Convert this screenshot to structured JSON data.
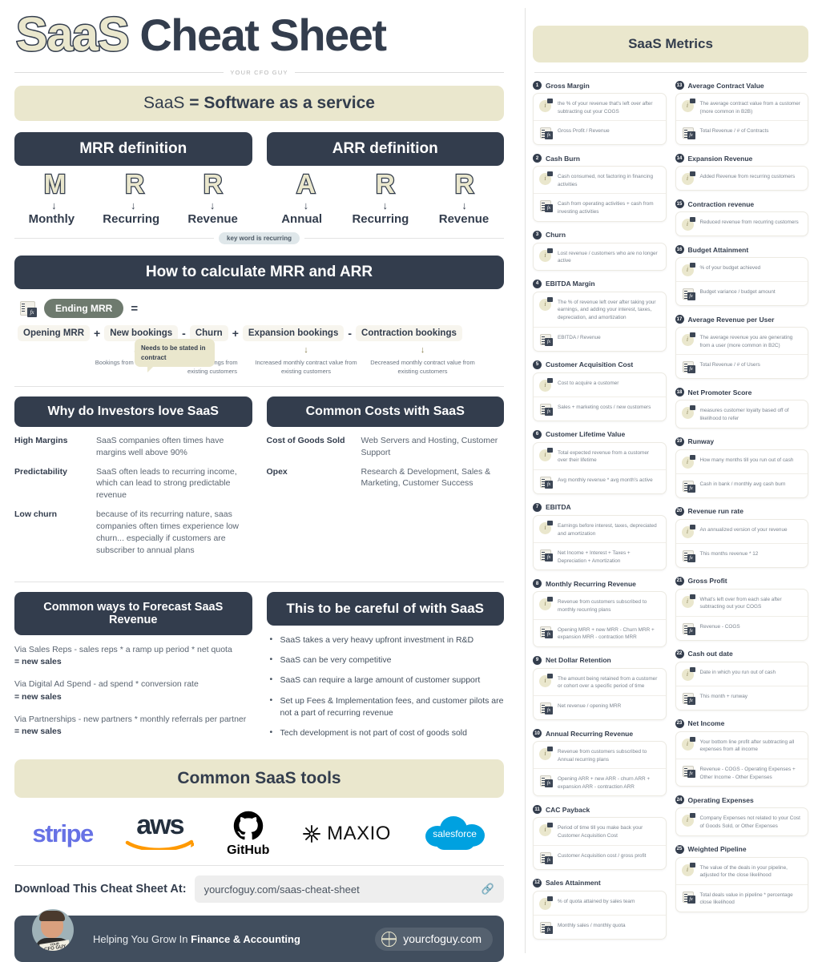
{
  "header": {
    "title_outline": "SaaS",
    "title_solid": "Cheat Sheet",
    "brand_line": "YOUR CFO GUY",
    "definition_light": "SaaS ",
    "definition_bold": "= Software as a service"
  },
  "mrr": {
    "heading": "MRR definition",
    "letters": [
      "M",
      "R",
      "R"
    ],
    "words": [
      "Monthly",
      "Recurring",
      "Revenue"
    ],
    "callout": "Needs to be stated in contract"
  },
  "arr": {
    "heading": "ARR definition",
    "letters": [
      "A",
      "R",
      "R"
    ],
    "words": [
      "Annual",
      "Recurring",
      "Revenue"
    ]
  },
  "keyword_badge": "key word is recurring",
  "calc": {
    "heading": "How to calculate MRR and ARR",
    "result_pill": "Ending MRR",
    "equals": "=",
    "terms": [
      "Opening MRR",
      "New bookings",
      "Churn",
      "Expansion bookings",
      "Contraction bookings"
    ],
    "operators": [
      "+",
      "-",
      "+",
      "-"
    ],
    "notes": [
      "",
      "Bookings from new customers",
      "Lost bookings from existing customers",
      "Increased monthly contract value from existing customers",
      "Decreased monthly contract value from existing customers"
    ]
  },
  "investors": {
    "heading": "Why do Investors love SaaS",
    "rows": [
      {
        "key": "High Margins",
        "value": "SaaS companies often times have margins well above 90%"
      },
      {
        "key": "Predictability",
        "value": "SaaS often leads to recurring income, which can lead to strong predictable revenue"
      },
      {
        "key": "Low churn",
        "value": "because of its recurring nature, saas companies often times experience low churn... especially if customers are subscriber to annual plans"
      }
    ]
  },
  "costs": {
    "heading": "Common Costs with SaaS",
    "rows": [
      {
        "key": "Cost of Goods Sold",
        "value": "Web Servers and Hosting, Customer Support"
      },
      {
        "key": "Opex",
        "value": "Research & Development, Sales & Marketing, Customer Success"
      }
    ]
  },
  "forecast": {
    "heading": "Common ways to Forecast SaaS Revenue",
    "items": [
      {
        "line": "Via Sales Reps - sales reps * a ramp up period * net quota",
        "result": "= new sales"
      },
      {
        "line": "Via Digital Ad Spend - ad spend * conversion rate",
        "result": "= new sales"
      },
      {
        "line": "Via Partnerships - new partners * monthly referrals per partner",
        "result": "= new sales"
      }
    ]
  },
  "careful": {
    "heading": "This to be careful of with SaaS",
    "items": [
      "SaaS takes a very heavy upfront investment in R&D",
      "SaaS can be very competitive",
      "SaaS can require a large amount of customer support",
      "Set up Fees & Implementation fees, and customer pilots are not a part of recurring revenue",
      "Tech development is not part of cost of goods sold"
    ]
  },
  "tools": {
    "heading": "Common SaaS tools",
    "logos": [
      "stripe",
      "aws",
      "GitHub",
      "MAXIO",
      "salesforce"
    ]
  },
  "download": {
    "label": "Download This Cheat Sheet At:",
    "url": "yourcfoguy.com/saas-cheat-sheet"
  },
  "footer": {
    "text_light": "Helping You Grow In ",
    "text_bold": "Finance & Accounting",
    "site": "yourcfoguy.com",
    "badge_small": "YOUR",
    "badge_main": "CFO GUY"
  },
  "metrics": {
    "heading": "SaaS Metrics",
    "left": [
      {
        "num": "1",
        "name": "Gross Margin",
        "desc": "the % of your revenue that's left over after subtracting out your COGS",
        "formula": "Gross Profit / Revenue"
      },
      {
        "num": "2",
        "name": "Cash Burn",
        "desc": "Cash consumed, not factoring in financing activities",
        "formula": "Cash from operating activities + cash from investing activities"
      },
      {
        "num": "3",
        "name": "Churn",
        "desc": "Lost revenue / customers who are no longer active",
        "formula": ""
      },
      {
        "num": "4",
        "name": "EBITDA Margin",
        "desc": "The % of revenue left over after taking your earnings, and adding your interest, taxes, depreciation, and amortization",
        "formula": "EBITDA / Revenue"
      },
      {
        "num": "5",
        "name": "Customer Acquisition Cost",
        "desc": "Cost to acquire a customer",
        "formula": "Sales + marketing costs / new customers"
      },
      {
        "num": "6",
        "name": "Customer Lifetime Value",
        "desc": "Total expected revenue from a customer over their lifetime",
        "formula": "Avg monthly revenue * avg month's active"
      },
      {
        "num": "7",
        "name": "EBITDA",
        "desc": "Earnings before interest, taxes, depreciated and amortization",
        "formula": "Net Income + Interest + Taxes + Depreciation + Amortization"
      },
      {
        "num": "8",
        "name": "Monthly Recurring Revenue",
        "desc": "Revenue from customers subscribed to monthly recurring plans",
        "formula": "Opening MRR + new MRR - Churn MRR + expansion MRR - contraction MRR"
      },
      {
        "num": "9",
        "name": "Net Dollar Retention",
        "desc": "The amount being retained from a customer or cohort over a specific period of time",
        "formula": "Net revenue / opening MRR"
      },
      {
        "num": "10",
        "name": "Annual Recurring Revenue",
        "desc": "Revenue from customers subscribed to Annual recurring plans",
        "formula": "Opening ARR + new ARR - churn ARR + expansion ARR - contraction ARR"
      },
      {
        "num": "11",
        "name": "CAC Payback",
        "desc": "Period of time till you make back your Customer Acquisition Cost",
        "formula": "Customer Acquisition cost / gross profit"
      },
      {
        "num": "12",
        "name": "Sales Attainment",
        "desc": "% of quota attained by sales team",
        "formula": "Monthly sales / monthly quota"
      }
    ],
    "right": [
      {
        "num": "13",
        "name": "Average Contract Value",
        "desc": "The average contract value from a customer (more common in B2B)",
        "formula": "Total Revenue / # of Contracts"
      },
      {
        "num": "14",
        "name": "Expansion Revenue",
        "desc": "Added Revenue from recurring customers",
        "formula": ""
      },
      {
        "num": "15",
        "name": "Contraction revenue",
        "desc": "Reduced revenue from recurring customers",
        "formula": ""
      },
      {
        "num": "16",
        "name": "Budget Attainment",
        "desc": "% of your budget achieved",
        "formula": "Budget variance / budget amount"
      },
      {
        "num": "17",
        "name": "Average Revenue per User",
        "desc": "The average revenue you are generating from a user (more common in B2C)",
        "formula": "Total Revenue / # of Users"
      },
      {
        "num": "18",
        "name": "Net Promoter Score",
        "desc": "measures customer loyalty based off of likelihood to refer",
        "formula": ""
      },
      {
        "num": "19",
        "name": "Runway",
        "desc": "How many months till you run out of cash",
        "formula": "Cash in bank / monthly avg cash burn"
      },
      {
        "num": "20",
        "name": "Revenue run rate",
        "desc": "An annualized version of your revenue",
        "formula": "This months revenue * 12"
      },
      {
        "num": "21",
        "name": "Gross Profit",
        "desc": "What's left over from each sale after subtracting out your COGS",
        "formula": "Revenue - COGS"
      },
      {
        "num": "22",
        "name": "Cash out date",
        "desc": "Date in which you run out of cash",
        "formula": "This month + runway"
      },
      {
        "num": "23",
        "name": "Net Income",
        "desc": "Your bottom line profit after subtracting all expenses from all income",
        "formula": "Revenue - COGS - Operating Expenses + Other Income - Other Expenses"
      },
      {
        "num": "24",
        "name": "Operating Expenses",
        "desc": "Company Expenses not related to your Cost of Goods Sold, or Other Expenses",
        "formula": ""
      },
      {
        "num": "25",
        "name": "Weighted Pipeline",
        "desc": "The value of the deals in your pipeline, adjusted for the close likelihood",
        "formula": "Total deals value in pipeline * percentage close likelihood"
      }
    ]
  }
}
